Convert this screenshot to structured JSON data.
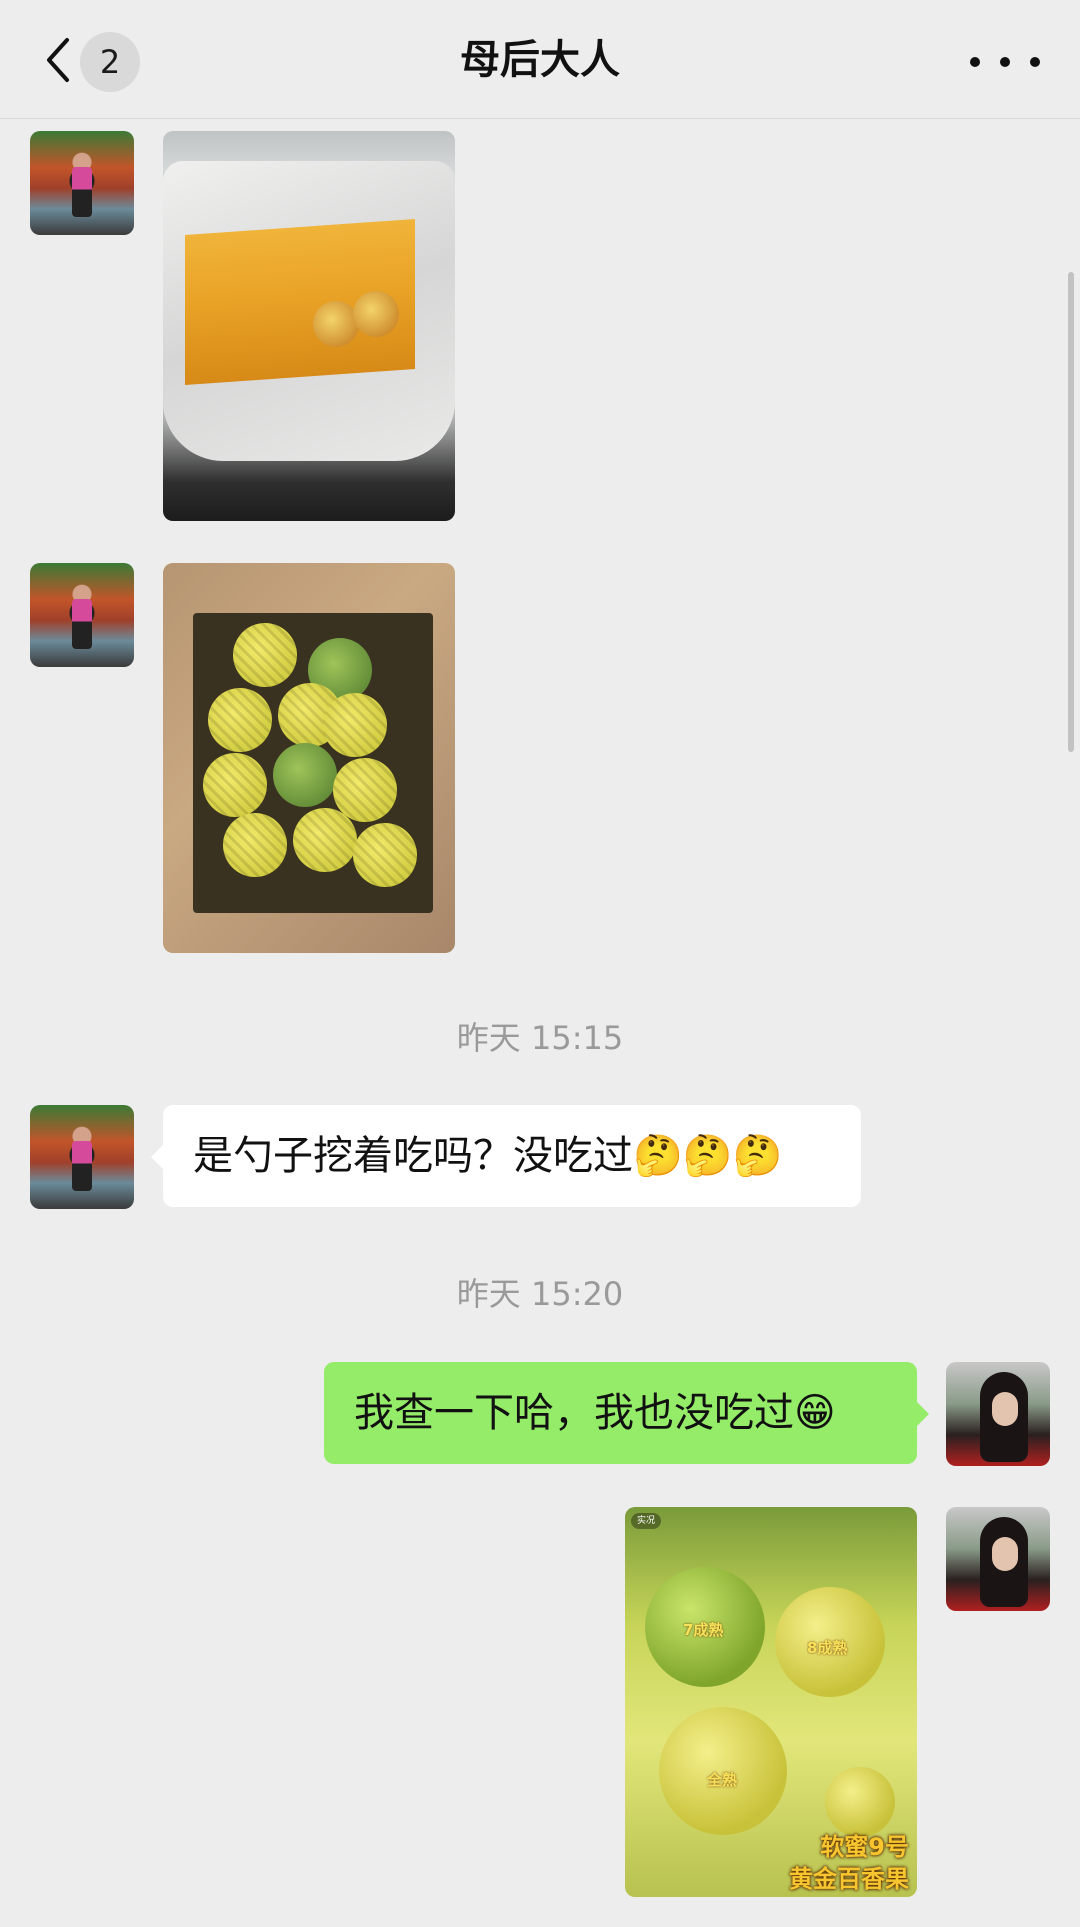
{
  "header": {
    "title": "母后大人",
    "unread_count": "2",
    "back_icon": "chevron-left-icon",
    "more_icon": "more-dots-icon"
  },
  "messages": [
    {
      "sender": "other",
      "type": "image",
      "content": "carton photo"
    },
    {
      "sender": "other",
      "type": "image",
      "content": "fruits in box photo"
    },
    {
      "type": "time",
      "text": "昨天 15:15"
    },
    {
      "sender": "other",
      "type": "text",
      "text": "是勺子挖着吃吗？没吃过🤔🤔🤔"
    },
    {
      "type": "time",
      "text": "昨天 15:20"
    },
    {
      "sender": "me",
      "type": "text",
      "text": "我查一下哈，我也没吃过😁"
    },
    {
      "sender": "me",
      "type": "image",
      "content": "promo photo"
    }
  ],
  "promo_image": {
    "tag": "实况",
    "line1": "软蜜9号",
    "line2": "黄金百香果",
    "ripe_7": "7成熟",
    "ripe_8": "8成熟",
    "ripe_full": "全熟"
  },
  "colors": {
    "background": "#ededed",
    "bubble_me": "#95ec69",
    "bubble_other": "#ffffff"
  }
}
